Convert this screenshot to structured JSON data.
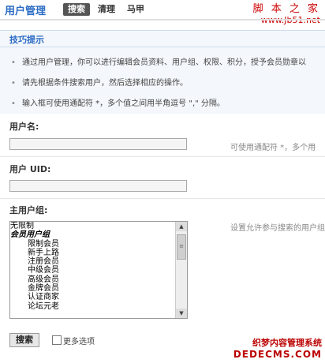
{
  "header": {
    "title": "用户管理",
    "tabs": [
      "搜索",
      "清理",
      "马甲"
    ]
  },
  "watermark_top": {
    "line1": "脚 本 之 家",
    "line2": "www.Jb51.net"
  },
  "tips": {
    "heading": "技巧提示",
    "items": [
      "通过用户管理，你可以进行编辑会员资料、用户组、权限、积分，授予会员勋章以",
      "请先根据条件搜索用户，然后选择相应的操作。",
      "输入框可使用通配符 *，多个值之间用半角逗号 \",\" 分隔。"
    ]
  },
  "form": {
    "username": {
      "label": "用户名:",
      "value": "",
      "hint": "可使用通配符 *，多个用"
    },
    "uid": {
      "label": "用户 UID:",
      "value": ""
    },
    "group": {
      "label": "主用户组:",
      "hint": "设置允许参与搜索的用户组",
      "options": [
        {
          "text": "无限制",
          "type": "plain"
        },
        {
          "text": "会员用户组",
          "type": "group"
        },
        {
          "text": "限制会员",
          "type": "indent"
        },
        {
          "text": "新手上路",
          "type": "indent"
        },
        {
          "text": "注册会员",
          "type": "indent"
        },
        {
          "text": "中级会员",
          "type": "indent"
        },
        {
          "text": "高级会员",
          "type": "indent"
        },
        {
          "text": "金牌会员",
          "type": "indent"
        },
        {
          "text": "认证商家",
          "type": "indent"
        },
        {
          "text": "论坛元老",
          "type": "indent"
        }
      ]
    },
    "search_button": "搜索",
    "more_options": "更多选项"
  },
  "watermark_bottom": {
    "line1": "织梦内容管理系统",
    "line2": "DEDECMS.COM"
  }
}
